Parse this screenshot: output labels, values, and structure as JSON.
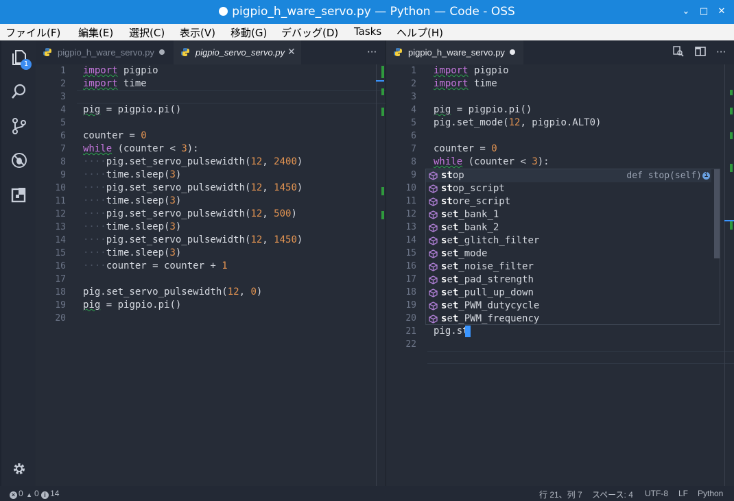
{
  "window": {
    "title": "pigpio_h_ware_servo.py — Python — Code - OSS",
    "minimize": "⌄",
    "maximize": "□",
    "close": "✕"
  },
  "menu": [
    "ファイル(F)",
    "編集(E)",
    "選択(C)",
    "表示(V)",
    "移動(G)",
    "デバッグ(D)",
    "Tasks",
    "ヘルプ(H)"
  ],
  "activity": {
    "explorer_badge": "1"
  },
  "left_editor": {
    "tabs": [
      {
        "label": "pigpio_h_ware_servo.py"
      },
      {
        "label": "pigpio_servo_servo.py"
      }
    ],
    "more": "···",
    "line_numbers": [
      "1",
      "2",
      "3",
      "4",
      "5",
      "6",
      "7",
      "8",
      "9",
      "10",
      "11",
      "12",
      "13",
      "14",
      "15",
      "16",
      "17",
      "18",
      "19",
      "20"
    ],
    "lines": {
      "l1": [
        "import",
        " pigpio"
      ],
      "l2": [
        "import",
        " time"
      ],
      "l4": [
        "pig",
        " = pigpio.pi()"
      ],
      "l6": [
        "counter = ",
        "0"
      ],
      "l7": [
        "while",
        " (counter < ",
        "3",
        "):"
      ],
      "l8": [
        "····",
        "pig.set_servo_pulsewidth(",
        "12",
        ", ",
        "2400",
        ")"
      ],
      "l9": [
        "····",
        "time.sleep(",
        "3",
        ")"
      ],
      "l10": [
        "····",
        "pig.set_servo_pulsewidth(",
        "12",
        ", ",
        "1450",
        ")"
      ],
      "l11": [
        "····",
        "time.sleep(",
        "3",
        ")"
      ],
      "l12": [
        "····",
        "pig.set_servo_pulsewidth(",
        "12",
        ", ",
        "500",
        ")"
      ],
      "l13": [
        "····",
        "time.sleep(",
        "3",
        ")"
      ],
      "l14": [
        "····",
        "pig.set_servo_pulsewidth(",
        "12",
        ", ",
        "1450",
        ")"
      ],
      "l15": [
        "····",
        "time.sleep(",
        "3",
        ")"
      ],
      "l16": [
        "····",
        "counter = counter + ",
        "1"
      ],
      "l18": [
        "pig.set_servo_pulsewidth(",
        "12",
        ", ",
        "0",
        ")"
      ],
      "l19": [
        "pig",
        " = pigpio.pi()"
      ]
    }
  },
  "right_editor": {
    "tab": {
      "label": "pigpio_h_ware_servo.py"
    },
    "more": "···",
    "line_numbers": [
      "1",
      "2",
      "3",
      "4",
      "5",
      "6",
      "7",
      "8",
      "9",
      "10",
      "11",
      "12",
      "13",
      "14",
      "15",
      "16",
      "17",
      "18",
      "19",
      "20",
      "21",
      "22"
    ],
    "lines": {
      "l1": [
        "import",
        " pigpio"
      ],
      "l2": [
        "import",
        " time"
      ],
      "l4": [
        "pig",
        " = pigpio.pi()"
      ],
      "l5": [
        "pig.set_mode(",
        "12",
        ", pigpio.ALT0)"
      ],
      "l7": [
        "counter = ",
        "0"
      ],
      "l8": [
        "while",
        " (counter < ",
        "3",
        "):"
      ],
      "l21": [
        "pig.st"
      ]
    }
  },
  "suggest": {
    "detail": "def stop(self)",
    "info": "i",
    "items": [
      {
        "bold": "st",
        "rest": "op"
      },
      {
        "bold": "st",
        "rest": "op_script"
      },
      {
        "bold": "st",
        "rest": "ore_script"
      },
      {
        "bold": "s",
        "mid": "e",
        "bold2": "t",
        "rest": "_bank_1"
      },
      {
        "bold": "s",
        "mid": "e",
        "bold2": "t",
        "rest": "_bank_2"
      },
      {
        "bold": "s",
        "mid": "e",
        "bold2": "t",
        "rest": "_glitch_filter"
      },
      {
        "bold": "s",
        "mid": "e",
        "bold2": "t",
        "rest": "_mode"
      },
      {
        "bold": "s",
        "mid": "e",
        "bold2": "t",
        "rest": "_noise_filter"
      },
      {
        "bold": "s",
        "mid": "e",
        "bold2": "t",
        "rest": "_pad_strength"
      },
      {
        "bold": "s",
        "mid": "e",
        "bold2": "t",
        "rest": "_pull_up_down"
      },
      {
        "bold": "s",
        "mid": "e",
        "bold2": "t",
        "rest": "_PWM_dutycycle"
      },
      {
        "bold": "s",
        "mid": "e",
        "bold2": "t",
        "rest": "_PWM_frequency"
      }
    ]
  },
  "status": {
    "errors": "0",
    "warnings": "0",
    "infos": "14",
    "position": "行 21、列 7",
    "spaces": "スペース: 4",
    "encoding": "UTF-8",
    "eol": "LF",
    "language": "Python"
  },
  "colors": {
    "accent": "#1b86dc",
    "keyword": "#c577dd",
    "number": "#e59552",
    "git_added": "#2f9a3d"
  }
}
